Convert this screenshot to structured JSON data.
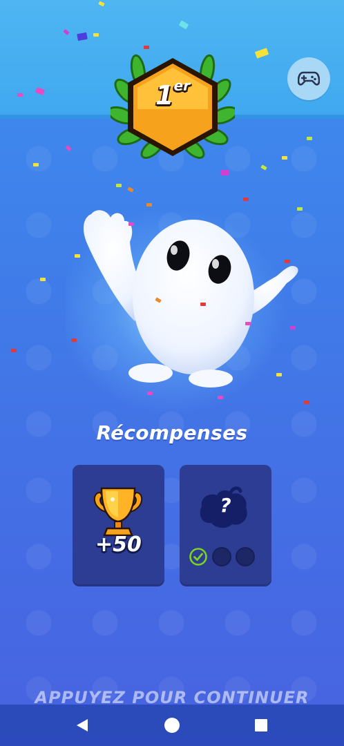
{
  "rank": {
    "number": "1",
    "suffix": "er"
  },
  "rewards": {
    "title": "Récompenses",
    "trophy_amount": "+50",
    "mystery_symbol": "?",
    "progress": {
      "completed": 1,
      "total": 3
    }
  },
  "continue_label": "APPUYEZ POUR CONTINUER",
  "controller_icon": "gamepad-icon",
  "colors": {
    "sky_top": "#4fb6f2",
    "background": "#4372e6",
    "card": "#2d3d93",
    "gold": "#f4a21a",
    "check_green": "#7ed321"
  }
}
